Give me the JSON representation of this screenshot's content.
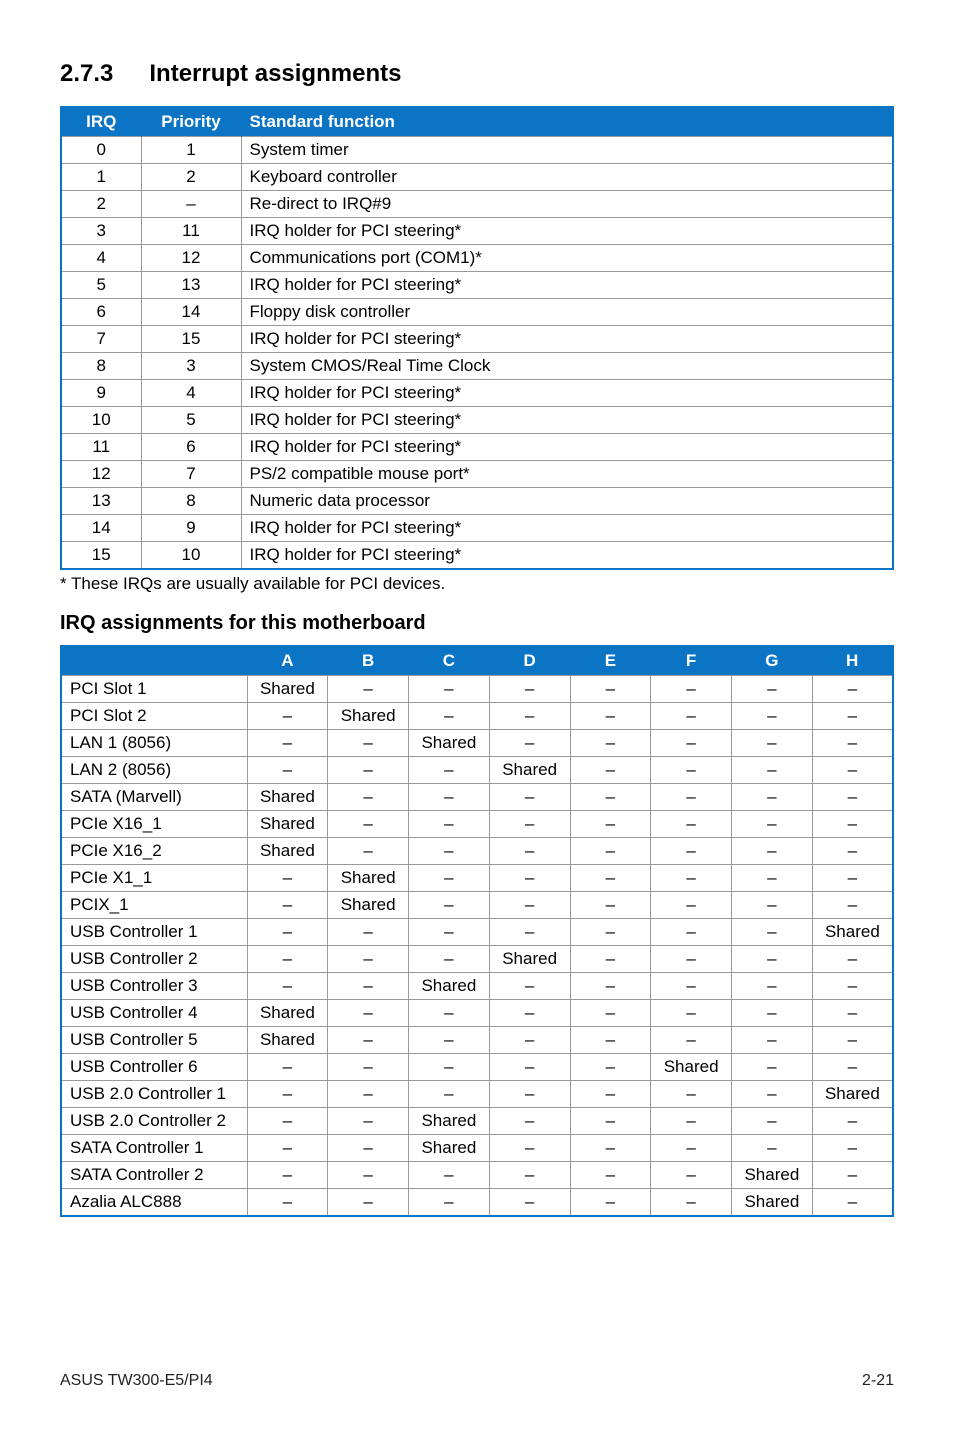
{
  "heading_num": "2.7.3",
  "heading_text": "Interrupt assignments",
  "table1": {
    "headers": [
      "IRQ",
      "Priority",
      "Standard function"
    ],
    "rows": [
      [
        "0",
        "1",
        "System timer"
      ],
      [
        "1",
        "2",
        "Keyboard controller"
      ],
      [
        "2",
        "–",
        "Re-direct to IRQ#9"
      ],
      [
        "3",
        "11",
        "IRQ holder for PCI steering*"
      ],
      [
        "4",
        "12",
        "Communications port (COM1)*"
      ],
      [
        "5",
        "13",
        "IRQ holder for PCI steering*"
      ],
      [
        "6",
        "14",
        "Floppy disk controller"
      ],
      [
        "7",
        "15",
        "IRQ holder for PCI steering*"
      ],
      [
        "8",
        "3",
        "System CMOS/Real Time Clock"
      ],
      [
        "9",
        "4",
        "IRQ holder for PCI steering*"
      ],
      [
        "10",
        "5",
        "IRQ holder for PCI steering*"
      ],
      [
        "11",
        "6",
        "IRQ holder for PCI steering*"
      ],
      [
        "12",
        "7",
        "PS/2 compatible mouse port*"
      ],
      [
        "13",
        "8",
        "Numeric data processor"
      ],
      [
        "14",
        "9",
        "IRQ holder for PCI steering*"
      ],
      [
        "15",
        "10",
        "IRQ holder for PCI steering*"
      ]
    ]
  },
  "footnote": "* These IRQs are usually available for PCI devices.",
  "subheading": "IRQ assignments for this motherboard",
  "table2": {
    "headers": [
      "",
      "A",
      "B",
      "C",
      "D",
      "E",
      "F",
      "G",
      "H"
    ],
    "rows": [
      [
        "PCI Slot 1",
        "Shared",
        "–",
        "–",
        "–",
        "–",
        "–",
        "–",
        "–"
      ],
      [
        "PCI Slot 2",
        "–",
        "Shared",
        "–",
        "–",
        "–",
        "–",
        "–",
        "–"
      ],
      [
        "LAN 1 (8056)",
        "–",
        "–",
        "Shared",
        "–",
        "–",
        "–",
        "–",
        "–"
      ],
      [
        "LAN 2 (8056)",
        "–",
        "–",
        "–",
        "Shared",
        "–",
        "–",
        "–",
        "–"
      ],
      [
        "SATA (Marvell)",
        "Shared",
        "–",
        "–",
        "–",
        "–",
        "–",
        "–",
        "–"
      ],
      [
        "PCIe X16_1",
        "Shared",
        "–",
        "–",
        "–",
        "–",
        "–",
        "–",
        "–"
      ],
      [
        "PCIe X16_2",
        "Shared",
        "–",
        "–",
        "–",
        "–",
        "–",
        "–",
        "–"
      ],
      [
        "PCIe X1_1",
        "–",
        "Shared",
        "–",
        "–",
        "–",
        "–",
        "–",
        "–"
      ],
      [
        "PCIX_1",
        "–",
        "Shared",
        "–",
        "–",
        "–",
        "–",
        "–",
        "–"
      ],
      [
        "USB Controller 1",
        "–",
        "–",
        "–",
        "–",
        "–",
        "–",
        "–",
        "Shared"
      ],
      [
        "USB Controller 2",
        "–",
        "–",
        "–",
        "Shared",
        "–",
        "–",
        "–",
        "–"
      ],
      [
        "USB Controller 3",
        "–",
        "–",
        "Shared",
        "–",
        "–",
        "–",
        "–",
        "–"
      ],
      [
        "USB Controller 4",
        "Shared",
        "–",
        "–",
        "–",
        "–",
        "–",
        "–",
        "–"
      ],
      [
        "USB Controller 5",
        "Shared",
        "–",
        "–",
        "–",
        "–",
        "–",
        "–",
        "–"
      ],
      [
        "USB Controller 6",
        "–",
        "–",
        "–",
        "–",
        "–",
        "Shared",
        "–",
        "–"
      ],
      [
        "USB 2.0 Controller 1",
        "–",
        "–",
        "–",
        "–",
        "–",
        "–",
        "–",
        "Shared"
      ],
      [
        "USB 2.0 Controller 2",
        "–",
        "–",
        "Shared",
        "–",
        "–",
        "–",
        "–",
        "–"
      ],
      [
        "SATA Controller 1",
        "–",
        "–",
        "Shared",
        "–",
        "–",
        "–",
        "–",
        "–"
      ],
      [
        "SATA Controller 2",
        "–",
        "–",
        "–",
        "–",
        "–",
        "–",
        "Shared",
        "–"
      ],
      [
        "Azalia ALC888",
        "–",
        "–",
        "–",
        "–",
        "–",
        "–",
        "Shared",
        "–"
      ]
    ]
  },
  "footer_left": "ASUS TW300-E5/PI4",
  "footer_right": "2-21"
}
